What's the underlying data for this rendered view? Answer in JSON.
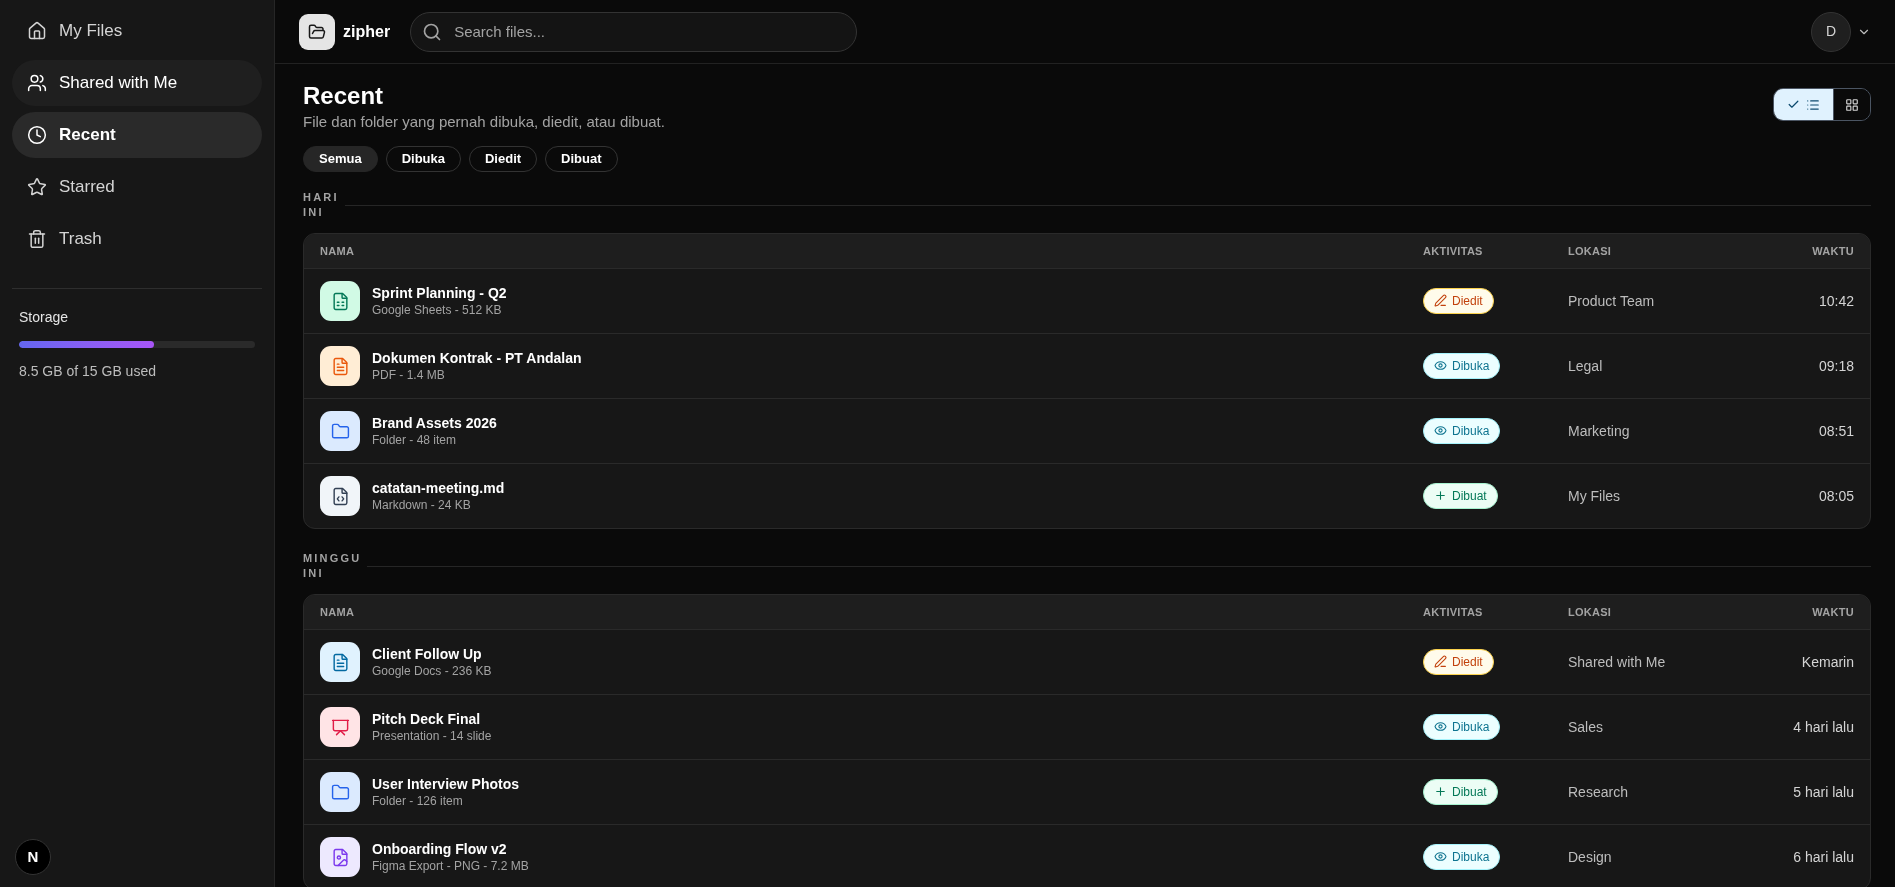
{
  "sidebar": {
    "items": [
      {
        "label": "My Files",
        "selected": false,
        "hovered": false
      },
      {
        "label": "Shared with Me",
        "selected": false,
        "hovered": true
      },
      {
        "label": "Recent",
        "selected": true,
        "hovered": false
      },
      {
        "label": "Starred",
        "selected": false,
        "hovered": false
      },
      {
        "label": "Trash",
        "selected": false,
        "hovered": false
      }
    ],
    "storage": {
      "label": "Storage",
      "level": 0.57,
      "usage": "8.5 GB of 15 GB used"
    },
    "dev_badge": "N"
  },
  "header": {
    "app_name": "zipher",
    "search": {
      "placeholder": "Search files..."
    },
    "avatar": "D"
  },
  "page": {
    "title": "Recent",
    "subtitle": "File dan folder yang pernah dibuka, diedit, atau dibuat.",
    "filters": [
      {
        "label": "Semua",
        "selected": true
      },
      {
        "label": "Dibuka",
        "selected": false
      },
      {
        "label": "Diedit",
        "selected": false
      },
      {
        "label": "Dibuat",
        "selected": false
      }
    ],
    "view_toggle": [
      {
        "kind": "list",
        "selected": true
      },
      {
        "kind": "grid",
        "selected": false
      }
    ]
  },
  "sections": [
    {
      "title": "HARI INI",
      "columns": [
        "NAMA",
        "AKTIVITAS",
        "LOKASI",
        "WAKTU"
      ],
      "rows": [
        {
          "kind": "sheet",
          "name": "Sprint Planning - Q2",
          "meta": "Google Sheets - 512 KB",
          "activity": {
            "kind": "edited",
            "label": "Diedit"
          },
          "location": "Product Team",
          "time": "10:42"
        },
        {
          "kind": "pdf",
          "name": "Dokumen Kontrak - PT Andalan",
          "meta": "PDF - 1.4 MB",
          "activity": {
            "kind": "opened",
            "label": "Dibuka"
          },
          "location": "Legal",
          "time": "09:18"
        },
        {
          "kind": "folder",
          "name": "Brand Assets 2026",
          "meta": "Folder - 48 item",
          "activity": {
            "kind": "opened",
            "label": "Dibuka"
          },
          "location": "Marketing",
          "time": "08:51"
        },
        {
          "kind": "code",
          "name": "catatan-meeting.md",
          "meta": "Markdown - 24 KB",
          "activity": {
            "kind": "created",
            "label": "Dibuat"
          },
          "location": "My Files",
          "time": "08:05"
        }
      ]
    },
    {
      "title": "MINGGU INI",
      "columns": [
        "NAMA",
        "AKTIVITAS",
        "LOKASI",
        "WAKTU"
      ],
      "rows": [
        {
          "kind": "doc",
          "name": "Client Follow Up",
          "meta": "Google Docs - 236 KB",
          "activity": {
            "kind": "edited",
            "label": "Diedit"
          },
          "location": "Shared with Me",
          "time": "Kemarin"
        },
        {
          "kind": "slides",
          "name": "Pitch Deck Final",
          "meta": "Presentation - 14 slide",
          "activity": {
            "kind": "opened",
            "label": "Dibuka"
          },
          "location": "Sales",
          "time": "4 hari lalu"
        },
        {
          "kind": "folder",
          "name": "User Interview Photos",
          "meta": "Folder - 126 item",
          "activity": {
            "kind": "created",
            "label": "Dibuat"
          },
          "location": "Research",
          "time": "5 hari lalu"
        },
        {
          "kind": "image",
          "name": "Onboarding Flow v2",
          "meta": "Figma Export - PNG - 7.2 MB",
          "activity": {
            "kind": "opened",
            "label": "Dibuka"
          },
          "location": "Design",
          "time": "6 hari lalu"
        }
      ]
    }
  ]
}
